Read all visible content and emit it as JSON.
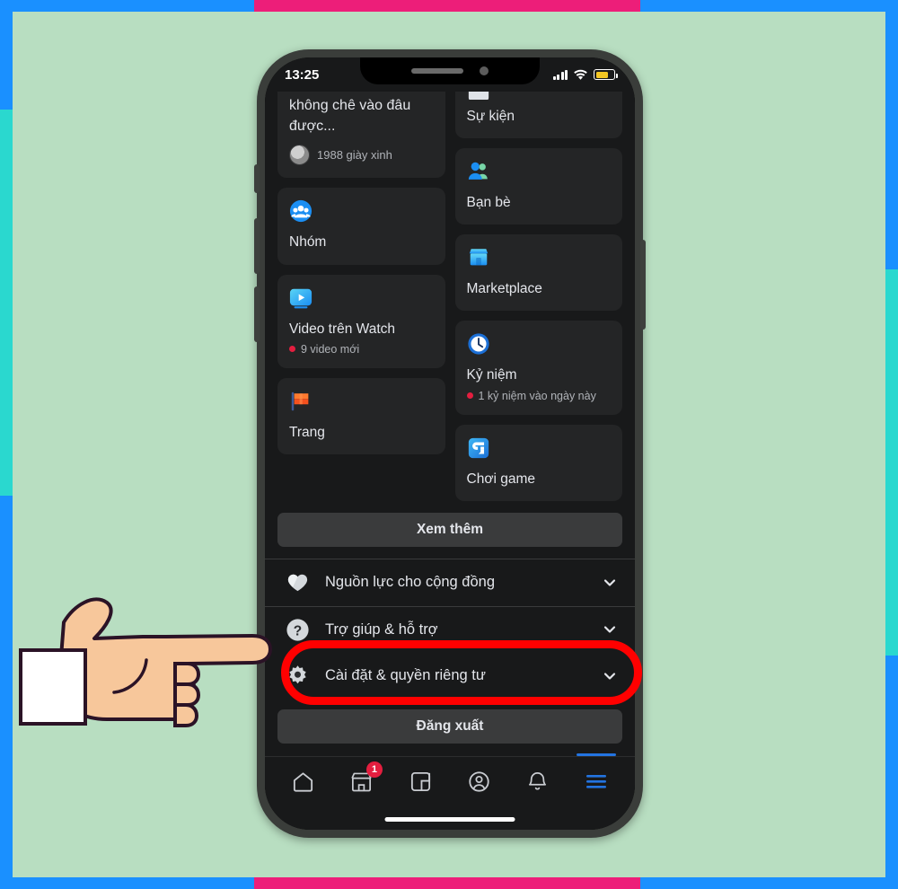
{
  "decor": {
    "canvas_bg": "#b8dec1",
    "border_blue": "#1a90ff",
    "border_pink": "#ed1e79",
    "border_teal": "#2ad8cf",
    "highlight_color": "#ff0000",
    "accent_blue": "#2374e1",
    "badge_red": "#e41e3f"
  },
  "status_bar": {
    "time": "13:25",
    "signal_icon": "signal-bars-icon",
    "wifi_icon": "wifi-icon",
    "battery_icon": "battery-icon"
  },
  "menu": {
    "left_column": [
      {
        "type": "story",
        "name": "story-card",
        "text": "không chê vào đâu được...",
        "author": "1988 giày xinh",
        "avatar_icon": "avatar-icon"
      },
      {
        "type": "tile",
        "name": "tile-groups",
        "label": "Nhóm",
        "icon": "groups-icon"
      },
      {
        "type": "tile",
        "name": "tile-watch",
        "label": "Video trên Watch",
        "icon": "watch-icon",
        "badge": "9 video mới"
      },
      {
        "type": "tile",
        "name": "tile-pages",
        "label": "Trang",
        "icon": "pages-flag-icon"
      }
    ],
    "right_column": [
      {
        "type": "tile",
        "name": "tile-events",
        "label": "Sự kiện",
        "icon": "events-icon",
        "clipped": true
      },
      {
        "type": "tile",
        "name": "tile-friends",
        "label": "Bạn bè",
        "icon": "friends-icon"
      },
      {
        "type": "tile",
        "name": "tile-marketplace",
        "label": "Marketplace",
        "icon": "marketplace-icon"
      },
      {
        "type": "tile",
        "name": "tile-memories",
        "label": "Kỷ niệm",
        "icon": "memories-clock-icon",
        "badge": "1 kỷ niệm vào ngày này"
      },
      {
        "type": "tile",
        "name": "tile-gaming",
        "label": "Chơi game",
        "icon": "gaming-icon"
      }
    ],
    "see_more_label": "Xem thêm",
    "rows": [
      {
        "name": "row-community-resources",
        "label": "Nguồn lực cho cộng đồng",
        "icon": "heart-hands-icon",
        "chevron": "chevron-down-icon"
      },
      {
        "name": "row-help-support",
        "label": "Trợ giúp & hỗ trợ",
        "icon": "question-mark-icon",
        "chevron": "chevron-down-icon"
      },
      {
        "name": "row-settings-privacy",
        "label": "Cài đặt & quyền riêng tư",
        "icon": "gear-icon",
        "chevron": "chevron-down-icon",
        "highlighted": true
      }
    ],
    "logout_label": "Đăng xuất"
  },
  "bottom_nav": [
    {
      "name": "nav-home",
      "icon": "home-icon",
      "badge": "",
      "active": false
    },
    {
      "name": "nav-marketplace",
      "icon": "shop-icon",
      "badge": "1",
      "active": false
    },
    {
      "name": "nav-watch",
      "icon": "video-square-icon",
      "badge": "",
      "active": false
    },
    {
      "name": "nav-profile",
      "icon": "person-circle-icon",
      "badge": "",
      "active": false
    },
    {
      "name": "nav-notifications",
      "icon": "bell-icon",
      "badge": "",
      "active": false
    },
    {
      "name": "nav-menu",
      "icon": "hamburger-icon",
      "badge": "",
      "active": true
    }
  ],
  "annotation": {
    "hand_icon": "pointing-hand-icon"
  }
}
